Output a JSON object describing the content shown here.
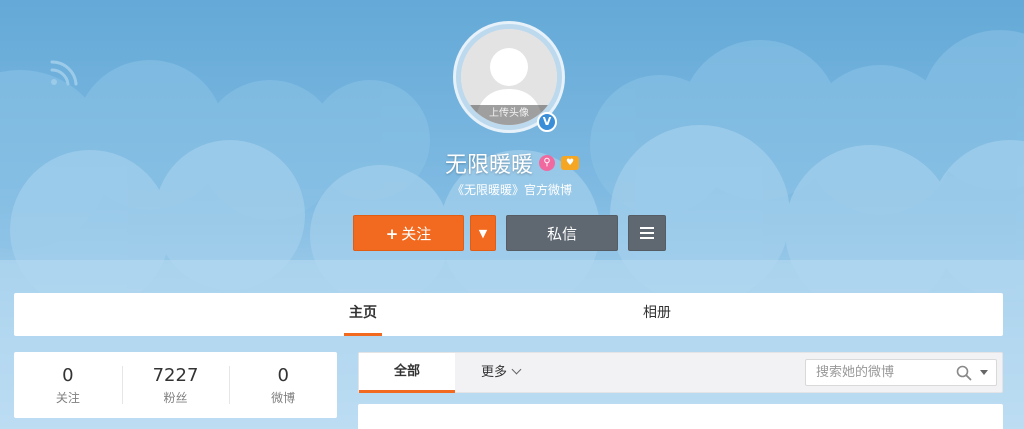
{
  "profile": {
    "upload_avatar_label": "上传头像",
    "verify_mark": "V",
    "name": "无限暖暖",
    "description": "《无限暖暖》官方微博"
  },
  "actions": {
    "follow_plus": "+",
    "follow_label": "关注",
    "dropdown_icon": "▼",
    "message_label": "私信"
  },
  "tabs": {
    "home": "主页",
    "album": "相册"
  },
  "stats": [
    {
      "value": "0",
      "label": "关注"
    },
    {
      "value": "7227",
      "label": "粉丝"
    },
    {
      "value": "0",
      "label": "微博"
    }
  ],
  "feed_filter": {
    "all": "全部",
    "more": "更多",
    "search_placeholder": "搜索她的微博"
  },
  "colors": {
    "accent": "#f26a1f",
    "sky_top": "#64a9d7",
    "sky_bottom": "#c3e0f3",
    "dark_button": "#5f6770"
  }
}
